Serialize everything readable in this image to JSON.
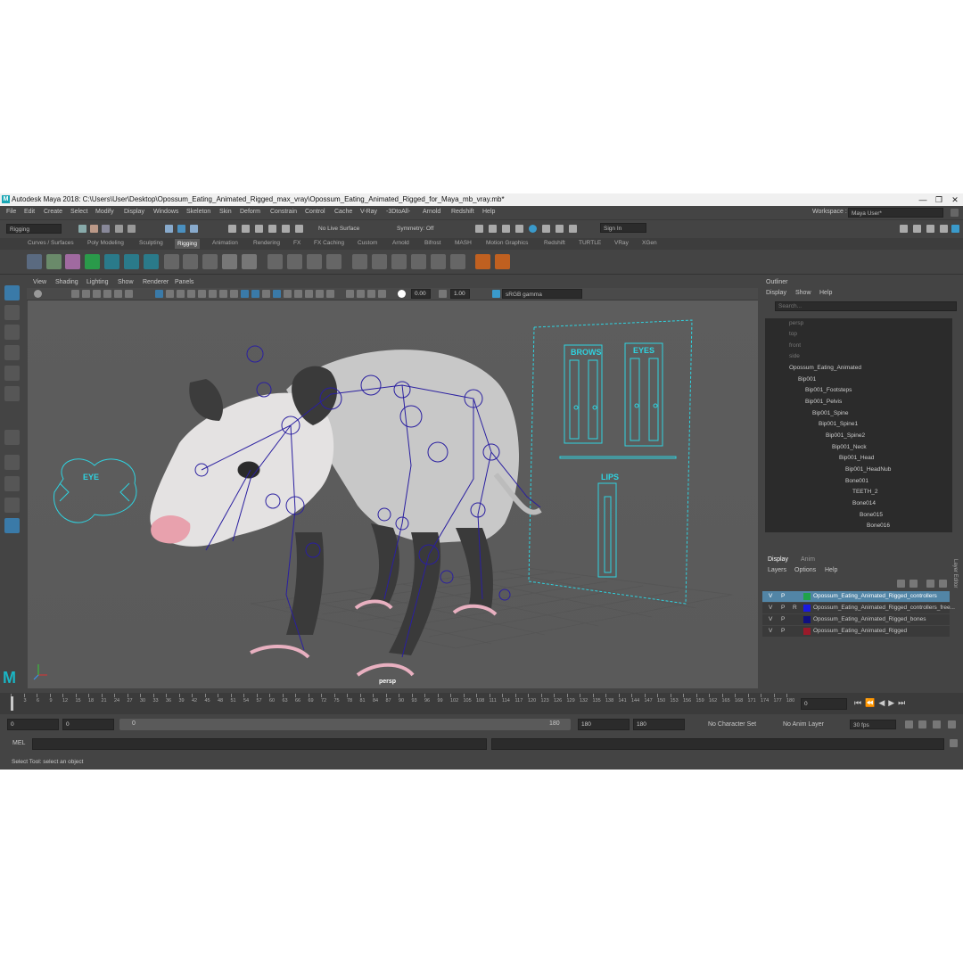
{
  "window": {
    "title": "Autodesk Maya 2018: C:\\Users\\User\\Desktop\\Opossum_Eating_Animated_Rigged_max_vray\\Opossum_Eating_Animated_Rigged_for_Maya_mb_vray.mb*",
    "logo_letter": "M",
    "minimize": "—",
    "maximize": "❐",
    "close": "✕"
  },
  "menubar": {
    "items": [
      "File",
      "Edit",
      "Create",
      "Select",
      "Modify",
      "Display",
      "Windows",
      "Skeleton",
      "Skin",
      "Deform",
      "Constrain",
      "Control",
      "Cache",
      "V-Ray",
      "-3DtoAll-",
      "Arnold",
      "Redshift",
      "Help"
    ],
    "workspace_label": "Workspace :",
    "workspace_value": "Maya User*"
  },
  "statusline": {
    "mode": "Rigging",
    "live_surface": "No Live Surface",
    "symmetry": "Symmetry: Off",
    "sign_in": "Sign In"
  },
  "shelf_tabs": {
    "items": [
      "Curves / Surfaces",
      "Poly Modeling",
      "Sculpting",
      "Rigging",
      "Animation",
      "Rendering",
      "FX",
      "FX Caching",
      "Custom",
      "Arnold",
      "Bifrost",
      "MASH",
      "Motion Graphics",
      "Redshift",
      "TURTLE",
      "VRay",
      "XGen"
    ],
    "active": "Rigging"
  },
  "panel": {
    "menus": [
      "View",
      "Shading",
      "Lighting",
      "Show",
      "Renderer",
      "Panels"
    ],
    "exposure": "0.00",
    "gamma": "1.00",
    "color_space": "sRGB gamma",
    "camera_label": "persp",
    "controls": {
      "brows": "BROWS",
      "eyes": "EYES",
      "lips": "LIPS",
      "eye": "EYE"
    }
  },
  "outliner": {
    "title": "Outliner",
    "menus": [
      "Display",
      "Show",
      "Help"
    ],
    "search_placeholder": "Search...",
    "items": [
      "persp",
      "top",
      "front",
      "side",
      "Opossum_Eating_Animated",
      "Bip001",
      "Bip001_Footsteps",
      "Bip001_Pelvis",
      "Bip001_Spine",
      "Bip001_Spine1",
      "Bip001_Spine2",
      "Bip001_Neck",
      "Bip001_Head",
      "Bip001_HeadNub",
      "Bone001",
      "TEETH_2",
      "Bone014",
      "Bone015",
      "Bone016"
    ]
  },
  "layer_editor": {
    "tabs": [
      "Display",
      "Anim"
    ],
    "menus": [
      "Layers",
      "Options",
      "Help"
    ],
    "side_label": "Layer Editor",
    "layers": [
      {
        "v": "V",
        "p": "P",
        "r": "",
        "name": "Opossum_Eating_Animated_Rigged_controllers",
        "color": "#1fa349"
      },
      {
        "v": "V",
        "p": "P",
        "r": "R",
        "name": "Opossum_Eating_Animated_Rigged_controllers_free...",
        "color": "#1a1ae0"
      },
      {
        "v": "V",
        "p": "P",
        "r": "",
        "name": "Opossum_Eating_Animated_Rigged_bones",
        "color": "#101080"
      },
      {
        "v": "V",
        "p": "P",
        "r": "",
        "name": "Opossum_Eating_Animated_Rigged",
        "color": "#9a1a2a"
      }
    ]
  },
  "timeline": {
    "ticks": [
      "0",
      "3",
      "6",
      "9",
      "12",
      "15",
      "18",
      "21",
      "24",
      "27",
      "30",
      "33",
      "36",
      "39",
      "42",
      "45",
      "48",
      "51",
      "54",
      "57",
      "60",
      "63",
      "66",
      "69",
      "72",
      "75",
      "78",
      "81",
      "84",
      "87",
      "90",
      "93",
      "96",
      "99",
      "102",
      "105",
      "108",
      "111",
      "114",
      "117",
      "120",
      "123",
      "126",
      "129",
      "132",
      "135",
      "138",
      "141",
      "144",
      "147",
      "150",
      "153",
      "156",
      "159",
      "162",
      "165",
      "168",
      "171",
      "174",
      "177",
      "180"
    ],
    "current_frame": "0"
  },
  "range": {
    "start": "0",
    "anim_start": "0",
    "slider_left": "0",
    "slider_right": "180",
    "anim_end": "180",
    "end": "180",
    "character_set": "No Character Set",
    "anim_layer": "No Anim Layer",
    "fps": "30 fps"
  },
  "command": {
    "label": "MEL"
  },
  "help_line": {
    "text": "Select Tool: select an object"
  }
}
